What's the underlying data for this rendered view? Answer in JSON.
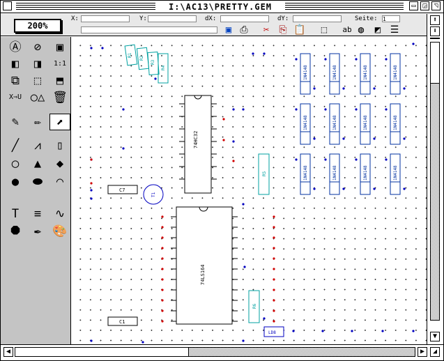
{
  "window": {
    "title": "I:\\AC13\\PRETTY.GEM"
  },
  "toolbar": {
    "zoom": "200%",
    "labels": {
      "x": "X:",
      "y": "Y:",
      "dx": "dX:",
      "dy": "dY:",
      "page": "Seite:"
    },
    "values": {
      "x": "",
      "y": "",
      "dx": "",
      "dy": "",
      "page": "1"
    },
    "icons": [
      "save-icon",
      "print-icon",
      "cut-icon",
      "copy-icon",
      "paste-icon",
      "crop-icon",
      "text-style-icon",
      "palette-icon",
      "gradient-icon",
      "line-style-icon"
    ]
  },
  "palette": {
    "tools": [
      {
        "name": "text-a-icon",
        "glyph": "Ⓐ"
      },
      {
        "name": "no-text-icon",
        "glyph": "⊘"
      },
      {
        "name": "picture-icon",
        "glyph": "▣"
      },
      {
        "name": "bring-front-icon",
        "glyph": "◧"
      },
      {
        "name": "send-back-icon",
        "glyph": "◨"
      },
      {
        "name": "zoom-1to1-button",
        "glyph": "1:1"
      },
      {
        "name": "image-swap-icon",
        "glyph": "⧉"
      },
      {
        "name": "group-icon",
        "glyph": "⬚"
      },
      {
        "name": "ungroup-icon",
        "glyph": "⬒"
      },
      {
        "name": "xu-convert-icon",
        "glyph": "X⇒U"
      },
      {
        "name": "shapes-icon",
        "glyph": "○△"
      },
      {
        "name": "trash-icon",
        "glyph": "🗑"
      },
      {
        "name": "eyedropper-icon",
        "glyph": "✎"
      },
      {
        "name": "pencil-icon",
        "glyph": "✏"
      },
      {
        "name": "select-arrow-icon",
        "glyph": "⬈"
      },
      {
        "name": "line-tool-icon",
        "glyph": "╱"
      },
      {
        "name": "polyline-tool-icon",
        "glyph": "⩘"
      },
      {
        "name": "rectangle-tool-icon",
        "glyph": "▯"
      },
      {
        "name": "ellipse-tool-icon",
        "glyph": "◯"
      },
      {
        "name": "triangle-tool-icon",
        "glyph": "▲"
      },
      {
        "name": "diamond-tool-icon",
        "glyph": "◆"
      },
      {
        "name": "circle-filled-tool-icon",
        "glyph": "●"
      },
      {
        "name": "ellipse-filled-tool-icon",
        "glyph": "⬬"
      },
      {
        "name": "arc-tool-icon",
        "glyph": "◠"
      },
      {
        "name": "text-tool-icon",
        "glyph": "T"
      },
      {
        "name": "paragraph-tool-icon",
        "glyph": "≡"
      },
      {
        "name": "bezier-tool-icon",
        "glyph": "∿"
      },
      {
        "name": "octagon-tool-icon",
        "glyph": "⯃"
      },
      {
        "name": "fountain-pen-icon",
        "glyph": "✒"
      },
      {
        "name": "color-palette-icon",
        "glyph": "🎨"
      }
    ],
    "selected_index": 14
  },
  "colors": {
    "ic": "#000000",
    "res": "#00a0a0",
    "lead": "#0000c0",
    "pin": "#d00000",
    "dio": "#0030a0"
  },
  "canvas": {
    "ic_labels": [
      "74HC32",
      "74LS164"
    ],
    "resistor_labels": [
      "R1",
      "R2",
      "R3",
      "R4",
      "R5",
      "R6"
    ],
    "diode_labels": [
      "1N4148"
    ],
    "cap_labels": [
      "C7",
      "C1"
    ],
    "transistor_label": "T1",
    "led_label": "LD8"
  }
}
